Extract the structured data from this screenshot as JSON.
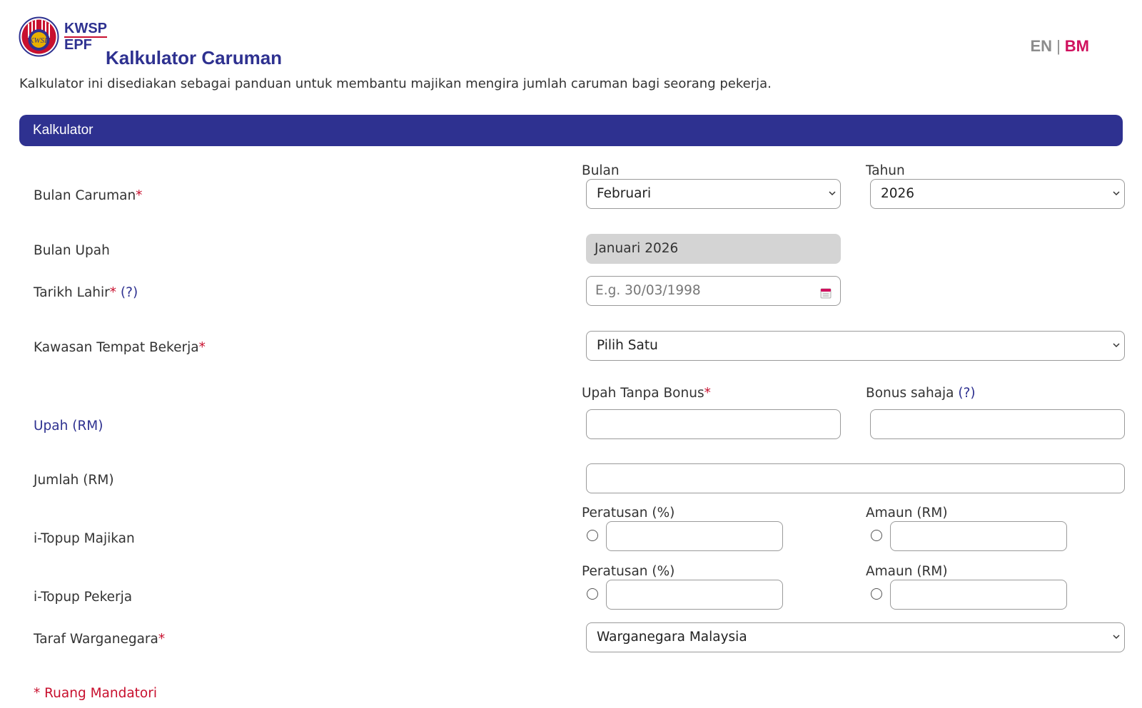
{
  "header": {
    "logo_line1": "KWSP",
    "logo_line2": "EPF",
    "title": "Kalkulator Caruman",
    "lang_en": "EN",
    "lang_sep": "|",
    "lang_bm": "BM",
    "description": "Kalkulator ini disediakan sebagai panduan untuk membantu majikan mengira jumlah caruman bagi seorang pekerja."
  },
  "banner": {
    "label": "Kalkulator"
  },
  "form": {
    "bulan_caruman": {
      "label": "Bulan Caruman",
      "sub_bulan": "Bulan",
      "sub_tahun": "Tahun",
      "bulan_value": "Februari",
      "tahun_value": "2026"
    },
    "bulan_upah": {
      "label": "Bulan Upah",
      "value": "Januari 2026"
    },
    "tarikh_lahir": {
      "label": "Tarikh Lahir",
      "help": "(?)",
      "placeholder": "E.g. 30/03/1998"
    },
    "kawasan": {
      "label": "Kawasan Tempat Bekerja",
      "value": "Pilih Satu"
    },
    "upah": {
      "label": "Upah (RM)",
      "sub_upah": "Upah Tanpa Bonus",
      "sub_bonus": "Bonus sahaja",
      "help": "(?)"
    },
    "jumlah": {
      "label": "Jumlah (RM)"
    },
    "topup_majikan": {
      "label": "i-Topup Majikan",
      "sub_pct": "Peratusan (%)",
      "sub_amt": "Amaun (RM)"
    },
    "topup_pekerja": {
      "label": "i-Topup Pekerja",
      "sub_pct": "Peratusan (%)",
      "sub_amt": "Amaun (RM)"
    },
    "warganegara": {
      "label": "Taraf Warganegara",
      "value": "Warganegara Malaysia"
    },
    "required_mark": "*",
    "mandatory_note": "* Ruang Mandatori"
  },
  "colors": {
    "brand_blue": "#2e3190",
    "required_red": "#c8102e",
    "bm_pink": "#d0105e"
  }
}
